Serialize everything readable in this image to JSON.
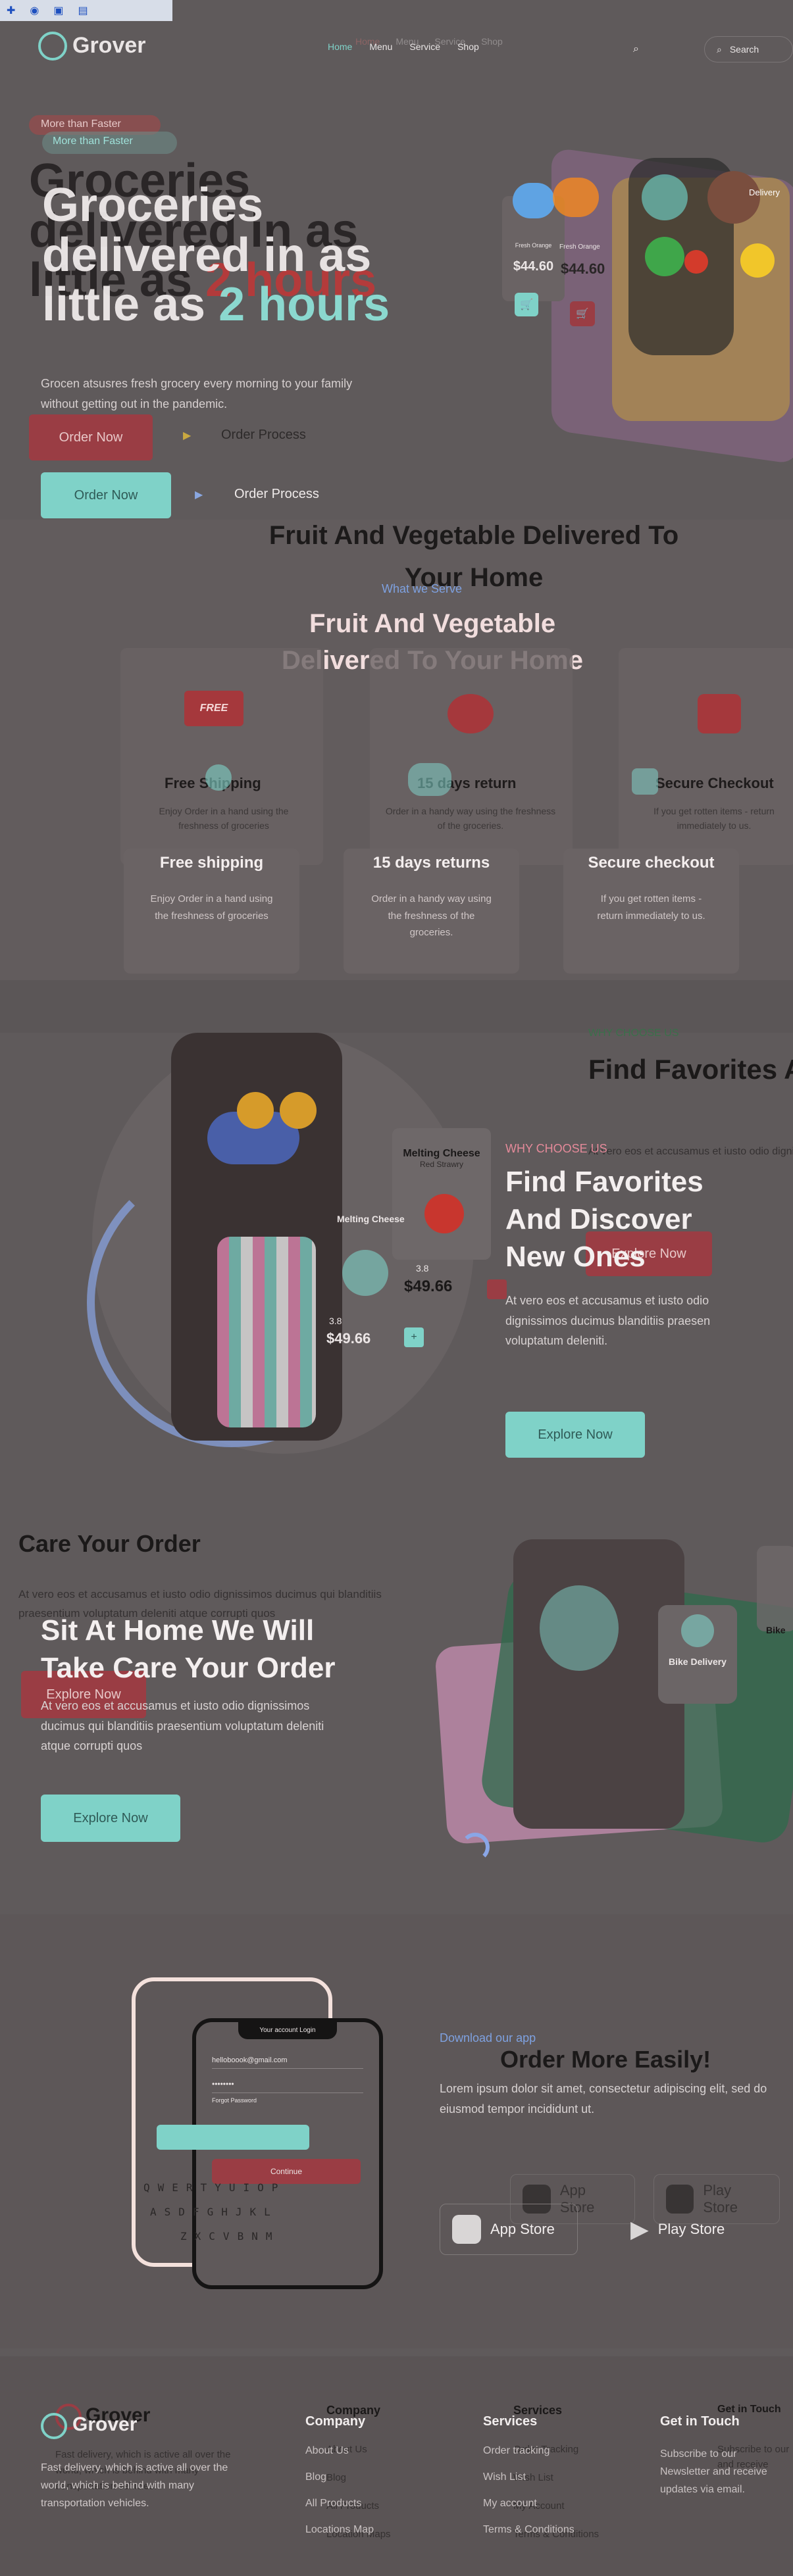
{
  "browser": {
    "icons": [
      "plus-icon",
      "eye-icon",
      "lock-icon",
      "bookmark-icon"
    ]
  },
  "brand": {
    "name": "Grover"
  },
  "nav": {
    "links": [
      "Home",
      "Menu",
      "Service",
      "Shop"
    ],
    "links_ghost": [
      "Home",
      "Menu",
      "Service",
      "Shop"
    ],
    "search_label": "Search"
  },
  "hero": {
    "badge": "More than Faster",
    "badge_ghost": "More than Faster",
    "title_line1": "Groceries",
    "title_line2": "delivered in as",
    "title_line3_a": "little as ",
    "title_line3_b": "2 hours",
    "text": "Grocen atsusres fresh grocery every morning to your family without getting out in the pandemic.",
    "order_button": "Order Now",
    "process_label": "Order Process",
    "card1": {
      "name": "Fresh Orange",
      "price": "$44.60"
    },
    "card2": {
      "name": "Fresh Orange",
      "price": "$44.60"
    },
    "delivery_label": "Delivery"
  },
  "services": {
    "eyebrow": "What we Serve",
    "title": "Fruit And Vegetable Delivered To Your Home",
    "items": [
      {
        "title": "Free shipping",
        "title_ghost": "Free Shipping",
        "text": "Enjoy Order in a hand using the freshness of groceries",
        "badge": "FREE"
      },
      {
        "title": "15 days returns",
        "title_ghost": "15 days return",
        "text": "Order in a handy way using the freshness of the groceries."
      },
      {
        "title": "Secure checkout",
        "title_ghost": "Secure Checkout",
        "text": "If you get rotten items - return immediately to us."
      }
    ]
  },
  "favorites": {
    "eyebrow": "WHY CHOOSE US",
    "title": "Find Favorites And Discover New Ones",
    "title_ghost": "Find Favorites And Discover New Ones",
    "text": "At vero eos et accusamus et iusto odio dignissimos ducimus blanditiis praesen voluptatum deleniti.",
    "button": "Explore Now",
    "product_name": "Melting Cheese",
    "product_sub": "Red Strawry",
    "rating": "3.8",
    "price": "$49.66"
  },
  "care": {
    "title": "Sit At Home We Will Take Care Your Order",
    "title_ghost": "Care Your Order",
    "text": "At vero eos et accusamus et iusto odio dignissimos ducimus qui blanditiis praesentium voluptatum deleniti atque corrupti quos",
    "button": "Explore Now",
    "bike_label": "Bike Delivery",
    "bike_ghost": "Bike"
  },
  "app": {
    "eyebrow": "Download our app",
    "title_ghost": "Order More Easily!",
    "text": "Lorem ipsum dolor sit amet, consectetur adipiscing elit, sed do eiusmod tempor incididunt ut.",
    "app_store": "App Store",
    "play_store": "Play Store",
    "phone": {
      "header": "Your account Login",
      "email": "helloboook@gmail.com",
      "password": "••••••••",
      "forgot": "Forgot Password",
      "button": "Continue",
      "keys_row1": [
        "Q",
        "W",
        "E",
        "R",
        "T",
        "Y",
        "U",
        "I",
        "O",
        "P"
      ],
      "keys_row2": [
        "A",
        "S",
        "D",
        "F",
        "G",
        "H",
        "J",
        "K",
        "L"
      ],
      "keys_row3": [
        "Z",
        "X",
        "C",
        "V",
        "B",
        "N",
        "M"
      ]
    }
  },
  "footer": {
    "about": "Fast delivery, which is active all over the world, which is behind with many transportation vehicles.",
    "about_ghost": "Fast delivery, which is active all over the world, which is behind with many transportation vehicles.",
    "columns": [
      {
        "title": "Company",
        "links": [
          "About Us",
          "Blog",
          "All Products",
          "Locations Map"
        ]
      },
      {
        "title": "Services",
        "links": [
          "Order tracking",
          "Wish List",
          "My account",
          "Terms & Conditions"
        ]
      },
      {
        "title": "Get in Touch",
        "links": [
          "Subscribe to our Newsletter and receive updates via email."
        ]
      }
    ],
    "columns_ghost": [
      {
        "title": "Company",
        "links": [
          "About Us",
          "Blog",
          "All Products",
          "Location Maps"
        ]
      },
      {
        "title": "Services",
        "links": [
          "Order Tracking",
          "Wish List",
          "My Account",
          "Terms & Conditions"
        ]
      },
      {
        "title": "Get in Touch",
        "links": [
          "Subscribe to our",
          "and receive"
        ]
      }
    ]
  }
}
